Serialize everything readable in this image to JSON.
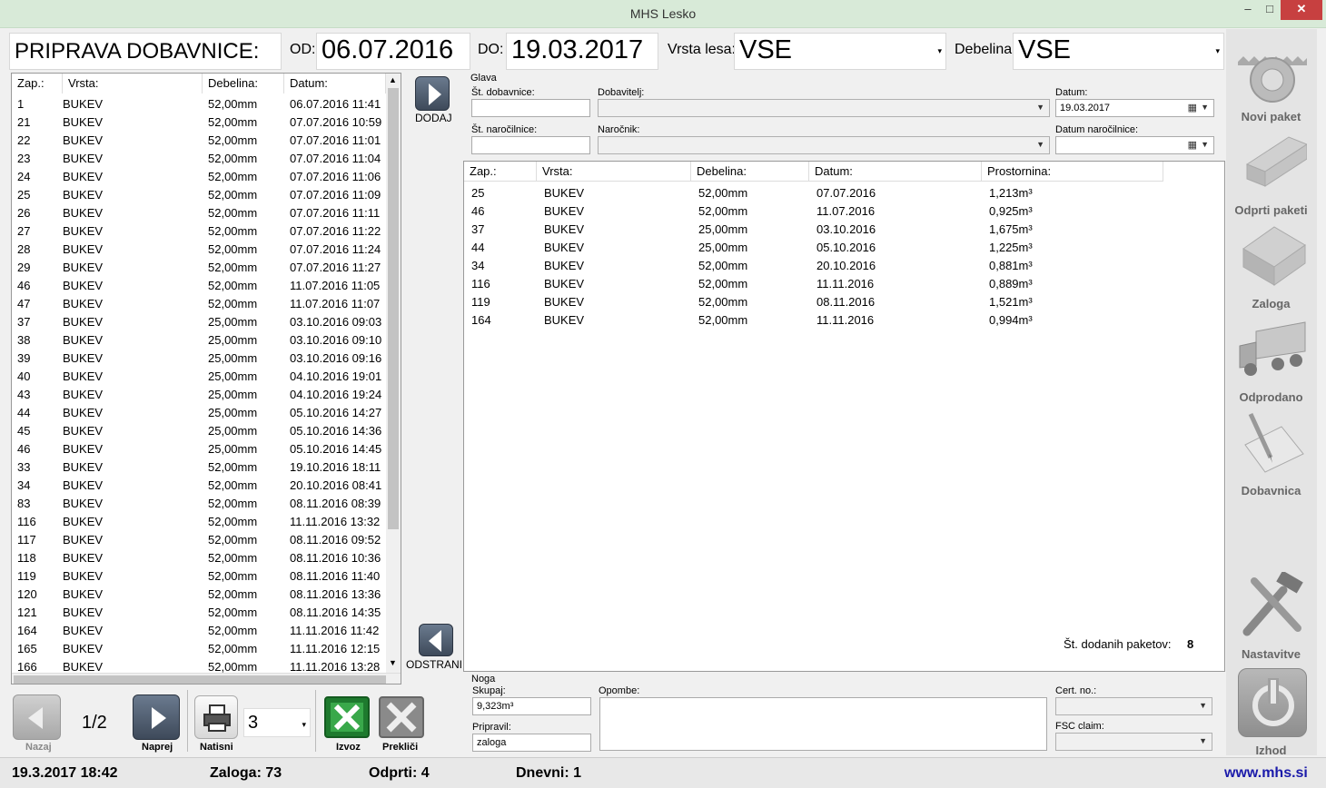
{
  "window": {
    "title": "MHS Lesko",
    "minimize": "‒",
    "maximize": "□",
    "close": "✕"
  },
  "header": {
    "title": "PRIPRAVA DOBAVNICE:",
    "od_label": "OD:",
    "od_value": "06.07.2016",
    "do_label": "DO:",
    "do_value": "19.03.2017",
    "vrsta_label": "Vrsta lesa:",
    "vrsta_value": "VSE",
    "debelina_label": "Debelina:",
    "debelina_value": "VSE"
  },
  "left_table": {
    "columns": [
      "Zap.:",
      "Vrsta:",
      "Debelina:",
      "Datum:"
    ],
    "rows": [
      [
        "1",
        "BUKEV",
        "52,00mm",
        "06.07.2016 11:41"
      ],
      [
        "21",
        "BUKEV",
        "52,00mm",
        "07.07.2016 10:59"
      ],
      [
        "22",
        "BUKEV",
        "52,00mm",
        "07.07.2016 11:01"
      ],
      [
        "23",
        "BUKEV",
        "52,00mm",
        "07.07.2016 11:04"
      ],
      [
        "24",
        "BUKEV",
        "52,00mm",
        "07.07.2016 11:06"
      ],
      [
        "25",
        "BUKEV",
        "52,00mm",
        "07.07.2016 11:09"
      ],
      [
        "26",
        "BUKEV",
        "52,00mm",
        "07.07.2016 11:11"
      ],
      [
        "27",
        "BUKEV",
        "52,00mm",
        "07.07.2016 11:22"
      ],
      [
        "28",
        "BUKEV",
        "52,00mm",
        "07.07.2016 11:24"
      ],
      [
        "29",
        "BUKEV",
        "52,00mm",
        "07.07.2016 11:27"
      ],
      [
        "46",
        "BUKEV",
        "52,00mm",
        "11.07.2016 11:05"
      ],
      [
        "47",
        "BUKEV",
        "52,00mm",
        "11.07.2016 11:07"
      ],
      [
        "37",
        "BUKEV",
        "25,00mm",
        "03.10.2016 09:03"
      ],
      [
        "38",
        "BUKEV",
        "25,00mm",
        "03.10.2016 09:10"
      ],
      [
        "39",
        "BUKEV",
        "25,00mm",
        "03.10.2016 09:16"
      ],
      [
        "40",
        "BUKEV",
        "25,00mm",
        "04.10.2016 19:01"
      ],
      [
        "43",
        "BUKEV",
        "25,00mm",
        "04.10.2016 19:24"
      ],
      [
        "44",
        "BUKEV",
        "25,00mm",
        "05.10.2016 14:27"
      ],
      [
        "45",
        "BUKEV",
        "25,00mm",
        "05.10.2016 14:36"
      ],
      [
        "46",
        "BUKEV",
        "25,00mm",
        "05.10.2016 14:45"
      ],
      [
        "33",
        "BUKEV",
        "52,00mm",
        "19.10.2016 18:11"
      ],
      [
        "34",
        "BUKEV",
        "52,00mm",
        "20.10.2016 08:41"
      ],
      [
        "83",
        "BUKEV",
        "52,00mm",
        "08.11.2016 08:39"
      ],
      [
        "116",
        "BUKEV",
        "52,00mm",
        "11.11.2016 13:32"
      ],
      [
        "117",
        "BUKEV",
        "52,00mm",
        "08.11.2016 09:52"
      ],
      [
        "118",
        "BUKEV",
        "52,00mm",
        "08.11.2016 10:36"
      ],
      [
        "119",
        "BUKEV",
        "52,00mm",
        "08.11.2016 11:40"
      ],
      [
        "120",
        "BUKEV",
        "52,00mm",
        "08.11.2016 13:36"
      ],
      [
        "121",
        "BUKEV",
        "52,00mm",
        "08.11.2016 14:35"
      ],
      [
        "164",
        "BUKEV",
        "52,00mm",
        "11.11.2016 11:42"
      ],
      [
        "165",
        "BUKEV",
        "52,00mm",
        "11.11.2016 12:15"
      ],
      [
        "166",
        "BUKEV",
        "52,00mm",
        "11.11.2016 13:28"
      ]
    ]
  },
  "transfer": {
    "add_label": "DODAJ",
    "remove_label": "ODSTRANI"
  },
  "glava": {
    "group_label": "Glava",
    "st_dobavnice_label": "Št. dobavnice:",
    "dobavitelj_label": "Dobavitelj:",
    "datum_label": "Datum:",
    "datum_value": "19.03.2017",
    "st_narocilnice_label": "Št. naročilnice:",
    "narocnik_label": "Naročnik:",
    "datum_narocilnice_label": "Datum naročilnice:"
  },
  "right_table": {
    "columns": [
      "Zap.:",
      "Vrsta:",
      "Debelina:",
      "Datum:",
      "Prostornina:"
    ],
    "rows": [
      [
        "25",
        "BUKEV",
        "52,00mm",
        "07.07.2016",
        "1,213m³"
      ],
      [
        "46",
        "BUKEV",
        "52,00mm",
        "11.07.2016",
        "0,925m³"
      ],
      [
        "37",
        "BUKEV",
        "25,00mm",
        "03.10.2016",
        "1,675m³"
      ],
      [
        "44",
        "BUKEV",
        "25,00mm",
        "05.10.2016",
        "1,225m³"
      ],
      [
        "34",
        "BUKEV",
        "52,00mm",
        "20.10.2016",
        "0,881m³"
      ],
      [
        "116",
        "BUKEV",
        "52,00mm",
        "11.11.2016",
        "0,889m³"
      ],
      [
        "119",
        "BUKEV",
        "52,00mm",
        "08.11.2016",
        "1,521m³"
      ],
      [
        "164",
        "BUKEV",
        "52,00mm",
        "11.11.2016",
        "0,994m³"
      ]
    ],
    "count_label": "Št. dodanih paketov:",
    "count_value": "8"
  },
  "noga": {
    "group_label": "Noga",
    "skupaj_label": "Skupaj:",
    "skupaj_value": "9,323m³",
    "pripravil_label": "Pripravil:",
    "pripravil_value": "zaloga",
    "opombe_label": "Opombe:",
    "cert_label": "Cert. no.:",
    "fsc_label": "FSC claim:"
  },
  "pager": {
    "back_label": "Nazaj",
    "page": "1/2",
    "next_label": "Naprej",
    "print_label": "Natisni",
    "copies": "3",
    "export_label": "Izvoz",
    "cancel_label": "Prekliči"
  },
  "sidebar": {
    "items": [
      {
        "label": "Novi paket",
        "icon": "saw-blade-icon"
      },
      {
        "label": "Odprti paketi",
        "icon": "lumber-icon"
      },
      {
        "label": "Zaloga",
        "icon": "stacked-lumber-icon"
      },
      {
        "label": "Odprodano",
        "icon": "truck-icon"
      },
      {
        "label": "Dobavnica",
        "icon": "document-pen-icon"
      }
    ],
    "settings_label": "Nastavitve",
    "exit_label": "Izhod"
  },
  "status": {
    "datetime": "19.3.2017 18:42",
    "zaloga": "Zaloga: 73",
    "odprti": "Odprti: 4",
    "dnevni": "Dnevni: 1",
    "website": "www.mhs.si"
  },
  "colors": {
    "titlebar": "#d8ead8",
    "close_button": "#c74040",
    "link": "#1a1aaa",
    "nav_button": "#4a5668"
  }
}
